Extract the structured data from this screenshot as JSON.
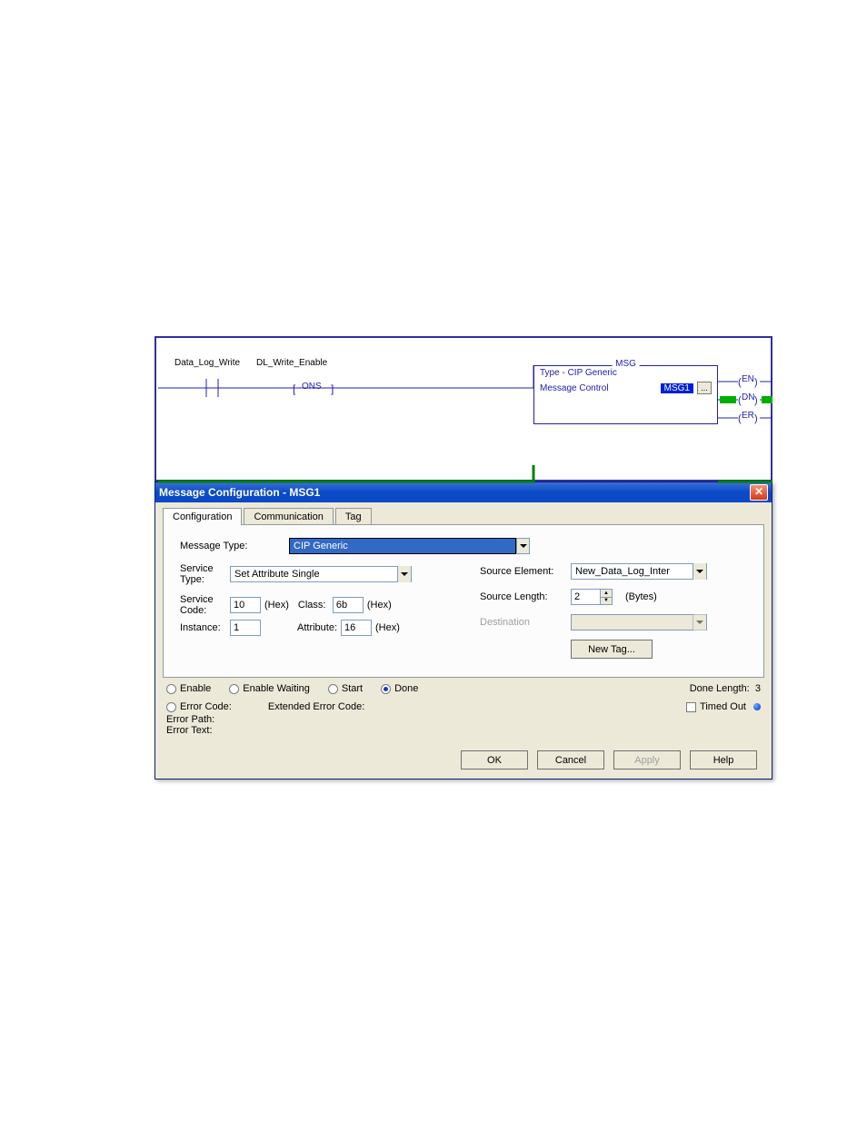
{
  "ladder": {
    "contact1": "Data_Log_Write",
    "contact2": "DL_Write_Enable",
    "ons": "ONS",
    "msg_block": {
      "title": "MSG",
      "type_label": "Type - CIP Generic",
      "control_label": "Message Control",
      "tag": "MSG1"
    },
    "coils": {
      "en": "EN",
      "dn": "DN",
      "er": "ER"
    }
  },
  "dialog": {
    "title": "Message Configuration - MSG1",
    "tabs": [
      "Configuration",
      "Communication",
      "Tag"
    ],
    "config": {
      "message_type_label": "Message Type:",
      "message_type_value": "CIP Generic",
      "service_type_label": "Service\nType:",
      "service_type_value": "Set Attribute Single",
      "service_code_label": "Service\nCode:",
      "service_code_value": "10",
      "hex": "(Hex)",
      "class_label": "Class:",
      "class_value": "6b",
      "instance_label": "Instance:",
      "instance_value": "1",
      "attribute_label": "Attribute:",
      "attribute_value": "16",
      "source_elem_label": "Source Element:",
      "source_elem_value": "New_Data_Log_Inter",
      "source_len_label": "Source Length:",
      "source_len_value": "2",
      "bytes": "(Bytes)",
      "destination_label": "Destination",
      "new_tag_btn": "New Tag..."
    },
    "status": {
      "enable": "Enable",
      "enable_waiting": "Enable Waiting",
      "start": "Start",
      "done": "Done",
      "done_length_label": "Done Length:",
      "done_length_value": "3",
      "error_code": "Error Code:",
      "ext_error_code": "Extended Error Code:",
      "timed_out": "Timed Out",
      "error_path": "Error Path:",
      "error_text": "Error Text:"
    },
    "buttons": {
      "ok": "OK",
      "cancel": "Cancel",
      "apply": "Apply",
      "help": "Help"
    }
  }
}
